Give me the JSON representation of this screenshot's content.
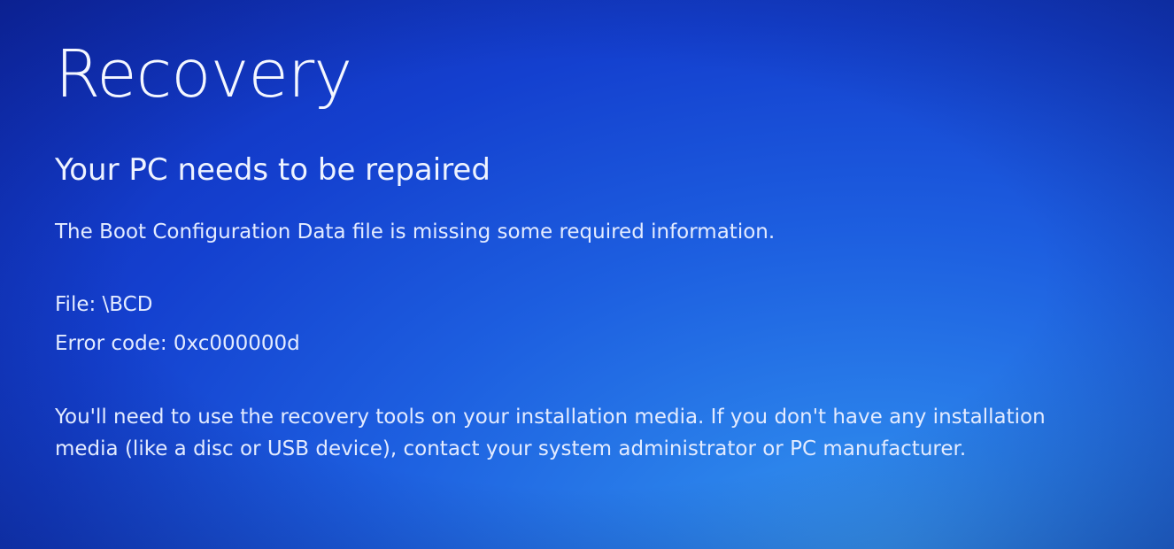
{
  "recovery_screen": {
    "title": "Recovery",
    "subtitle": "Your PC needs to be repaired",
    "description": "The Boot Configuration Data file is missing some required information.",
    "file_line": "File: \\BCD",
    "error_line": "Error code: 0xc000000d",
    "help_line_1": "You'll need to use the recovery tools on your installation media. If you don't have any installation",
    "help_line_2": "media (like a disc or USB device), contact your system administrator or PC manufacturer."
  },
  "colors": {
    "background_blue": "#1d5fe0",
    "text_white": "#f2f6ff"
  }
}
